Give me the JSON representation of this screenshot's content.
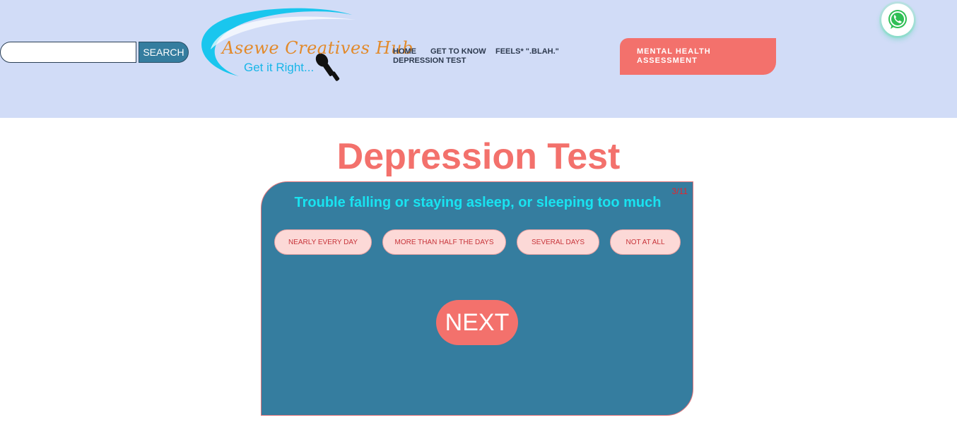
{
  "search": {
    "value": "",
    "placeholder": "",
    "button_label": "SEARCH"
  },
  "logo": {
    "title": "Asewe Creatives Hub",
    "tagline": "Get it Right..."
  },
  "nav": {
    "items": [
      {
        "label": "HOME"
      },
      {
        "label": "GET TO KNOW"
      },
      {
        "label": "FEELS* \".BLAH.\""
      },
      {
        "label": "DEPRESSION TEST"
      }
    ]
  },
  "cta": {
    "label": "MENTAL HEALTH ASSESSMENT"
  },
  "whatsapp": {
    "icon": "whatsapp-icon"
  },
  "page": {
    "title": "Depression Test"
  },
  "quiz": {
    "progress": "3/11",
    "question": "Trouble falling or staying asleep, or sleeping too much",
    "options": [
      {
        "label": "NEARLY EVERY DAY"
      },
      {
        "label": "MORE THAN HALF THE DAYS"
      },
      {
        "label": "SEVERAL DAYS"
      },
      {
        "label": "NOT AT ALL"
      }
    ],
    "next_label": "NEXT"
  },
  "colors": {
    "header_bg": "#d1dcf7",
    "accent": "#f3716c",
    "card_bg": "#357d9f",
    "question_text": "#19e3f0",
    "option_bg": "#fcd9d7"
  }
}
